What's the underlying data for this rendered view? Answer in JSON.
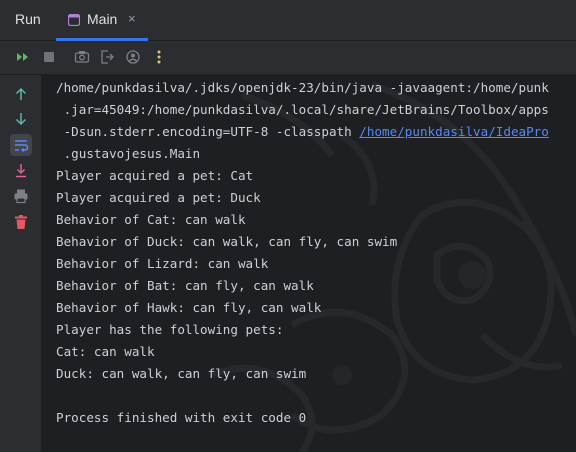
{
  "header": {
    "run_label": "Run",
    "tab": {
      "label": "Main",
      "close": "×"
    }
  },
  "toolbar": {
    "buttons": [
      "rerun-icon",
      "stop-icon",
      "screenshot-icon",
      "exit-icon",
      "profile-icon",
      "more-icon"
    ]
  },
  "gutter": {
    "buttons": [
      "arrow-up-icon",
      "arrow-down-icon",
      "soft-wrap-icon",
      "scroll-to-end-icon",
      "print-icon",
      "trash-icon"
    ]
  },
  "console": {
    "cmd_line1": "/home/punkdasilva/.jdks/openjdk-23/bin/java -javaagent:/home/punk",
    "cmd_line2": " .jar=45049:/home/punkdasilva/.local/share/JetBrains/Toolbox/apps",
    "cmd_line3_prefix": " -Dsun.stderr.encoding=UTF-8 -classpath ",
    "cmd_line3_link": "/home/punkdasilva/IdeaPro",
    "cmd_line4": " .gustavojesus.Main",
    "output": [
      "Player acquired a pet: Cat",
      "Player acquired a pet: Duck",
      "Behavior of Cat: can walk",
      "Behavior of Duck: can walk, can fly, can swim",
      "Behavior of Lizard: can walk",
      "Behavior of Bat: can fly, can walk",
      "Behavior of Hawk: can fly, can walk",
      "Player has the following pets:",
      "Cat: can walk",
      "Duck: can walk, can fly, can swim"
    ],
    "exit_message": "Process finished with exit code 0"
  },
  "colors": {
    "accent": "#3574f0",
    "link": "#548af7",
    "run_green": "#5fb865",
    "stop_gray": "#6f737a",
    "more_yellow": "#e5c07b",
    "delete_red": "#e55765",
    "scroll_pink": "#e0609a"
  }
}
